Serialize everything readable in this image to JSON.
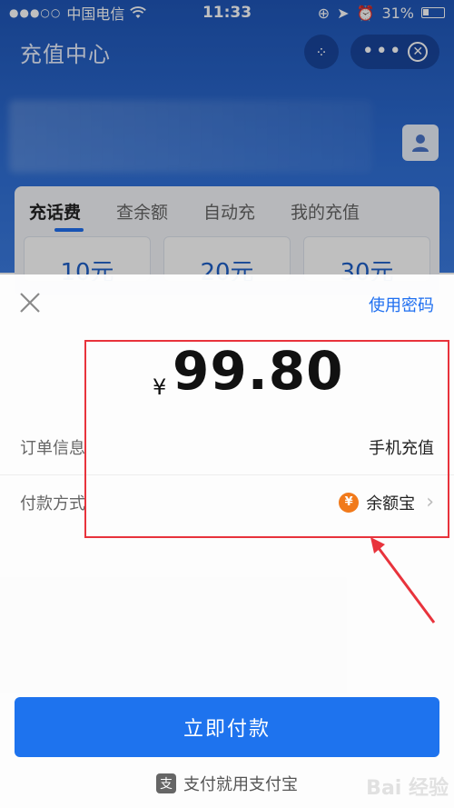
{
  "status_bar": {
    "carrier": "中国电信",
    "time": "11:33",
    "battery": "31%"
  },
  "app": {
    "title": "充值中心",
    "tabs": [
      {
        "label": "充话费",
        "active": true
      },
      {
        "label": "查余额",
        "active": false
      },
      {
        "label": "自动充",
        "active": false
      },
      {
        "label": "我的充值",
        "active": false
      }
    ],
    "amount_chips": [
      "10元",
      "20元",
      "30元"
    ]
  },
  "sheet": {
    "use_password": "使用密码",
    "currency_symbol": "¥",
    "amount": "99.80",
    "order_info_label": "订单信息",
    "order_info_value": "手机充值",
    "payment_method_label": "付款方式",
    "payment_method_value": "余额宝",
    "payment_icon_char": "¥",
    "pay_button": "立即付款",
    "footer_text": "支付就用支付宝",
    "footer_mark": "支"
  },
  "watermark": "Bai 经验",
  "colors": {
    "accent": "#1e73ee",
    "header_blue": "#2f6fd6",
    "annotation_red": "#e8333c",
    "yuebao_orange": "#f17a1b"
  }
}
